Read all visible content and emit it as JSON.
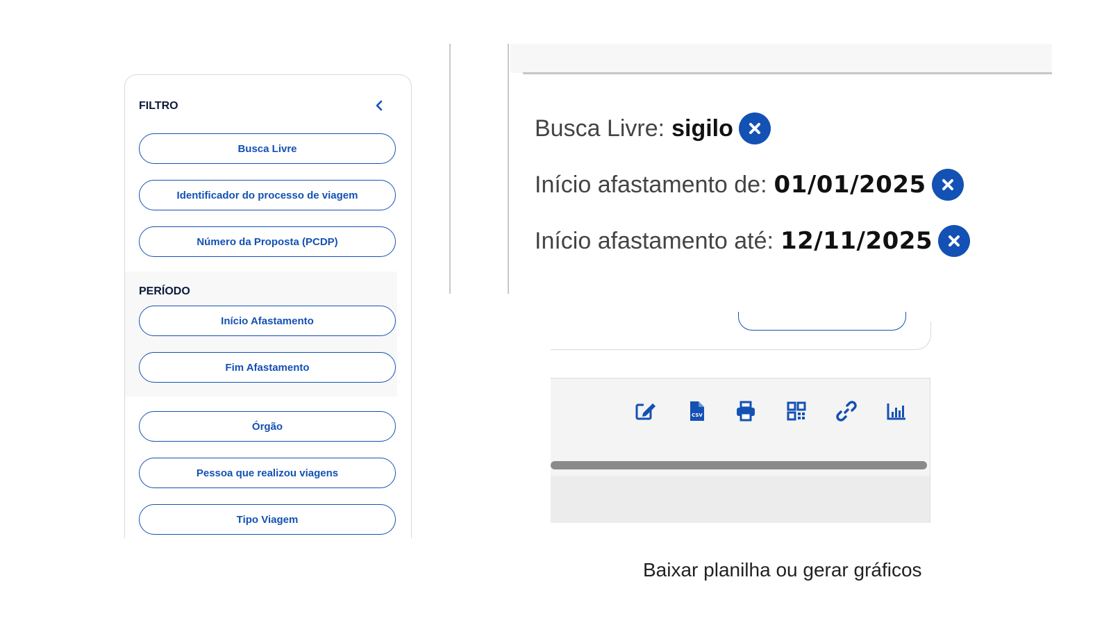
{
  "filter_panel": {
    "title": "FILTRO",
    "buttons_top": [
      {
        "label": "Busca Livre"
      },
      {
        "label": "Identificador do processo de viagem"
      },
      {
        "label": "Número da Proposta (PCDP)"
      }
    ],
    "period_title": "PERÍODO",
    "buttons_period": [
      {
        "label": "Início Afastamento"
      },
      {
        "label": "Fim Afastamento"
      }
    ],
    "buttons_bottom": [
      {
        "label": "Órgão"
      },
      {
        "label": "Pessoa que realizou viagens"
      },
      {
        "label": "Tipo Viagem"
      }
    ]
  },
  "active_filters": [
    {
      "label": "Busca Livre:",
      "value": "sigilo"
    },
    {
      "label": "Início afastamento de:",
      "value": "01/01/2025"
    },
    {
      "label": "Início afastamento até:",
      "value": "12/11/2025"
    }
  ],
  "toolbar": {
    "icons": [
      "edit-icon",
      "csv-file-icon",
      "print-icon",
      "qr-code-icon",
      "link-icon",
      "bar-chart-icon"
    ],
    "accent_color": "#1351b4"
  },
  "caption": "Baixar planilha ou gerar gráficos"
}
